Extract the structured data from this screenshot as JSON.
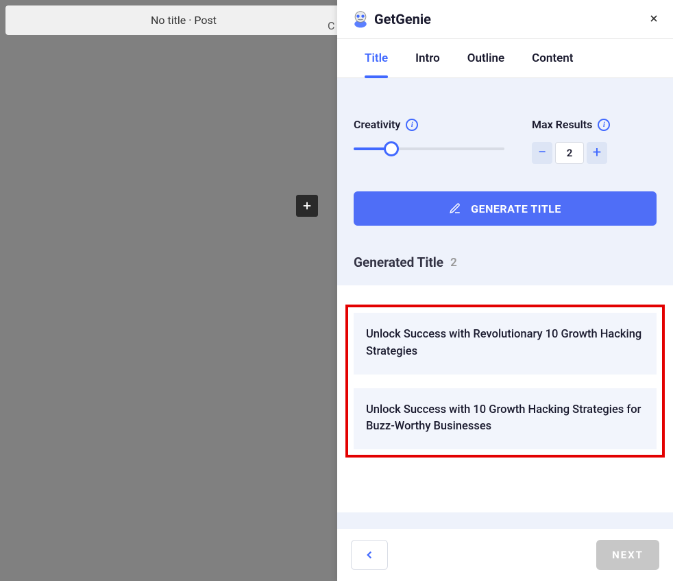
{
  "topbar": {
    "title": "No title · Post"
  },
  "panel": {
    "logo_text": "GetGenie",
    "tabs": [
      {
        "label": "Title",
        "active": true
      },
      {
        "label": "Intro",
        "active": false
      },
      {
        "label": "Outline",
        "active": false
      },
      {
        "label": "Content",
        "active": false
      }
    ],
    "creativity_label": "Creativity",
    "max_results_label": "Max Results",
    "max_results_value": "2",
    "generate_label": "GENERATE TITLE",
    "generated_title_label": "Generated Title",
    "generated_count": "2",
    "results": [
      "Unlock Success with Revolutionary 10 Growth Hacking Strategies",
      "Unlock Success with 10 Growth Hacking Strategies for Buzz-Worthy Businesses"
    ],
    "next_label": "NEXT"
  },
  "colors": {
    "accent": "#4169ff",
    "button": "#4f6ef7",
    "highlight_border": "#e30000"
  }
}
